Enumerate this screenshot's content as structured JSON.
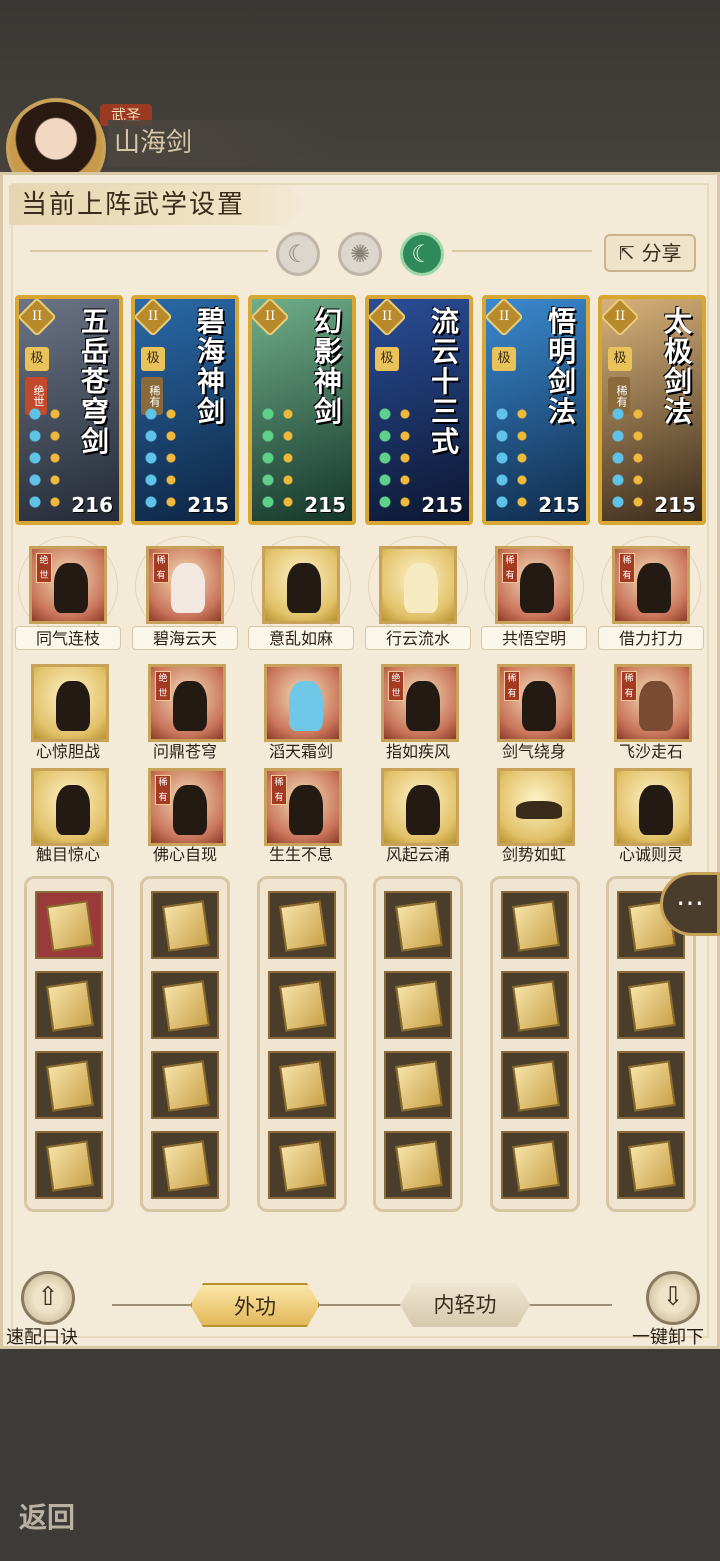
{
  "header": {
    "rank": "武圣",
    "current_skill": "山海剑"
  },
  "panel": {
    "title": "当前上阵武学设置",
    "share_label": "分享",
    "share_icon": "share-icon"
  },
  "modes": [
    {
      "name": "moon-mode",
      "icon": "crescent-icon"
    },
    {
      "name": "sun-mode",
      "icon": "sun-icon"
    },
    {
      "name": "jade-mode",
      "icon": "jade-moon-icon",
      "active": true
    }
  ],
  "cards": [
    {
      "name": "五岳苍穹剑",
      "level": "II",
      "grade": "极",
      "rarity": "绝世",
      "power": "216"
    },
    {
      "name": "碧海神剑",
      "level": "II",
      "grade": "极",
      "rarity": "稀有",
      "power": "215"
    },
    {
      "name": "幻影神剑",
      "level": "II",
      "grade": "",
      "rarity": "",
      "power": "215"
    },
    {
      "name": "流云十三式",
      "level": "II",
      "grade": "极",
      "rarity": "",
      "power": "215"
    },
    {
      "name": "悟明剑法",
      "level": "II",
      "grade": "极",
      "rarity": "",
      "power": "215"
    },
    {
      "name": "太极剑法",
      "level": "II",
      "grade": "极",
      "rarity": "稀有",
      "power": "215"
    }
  ],
  "skills_row1": [
    {
      "label": "同气连枝",
      "tag": "绝世"
    },
    {
      "label": "碧海云天",
      "tag": "稀有"
    },
    {
      "label": "意乱如麻",
      "tag": ""
    },
    {
      "label": "行云流水",
      "tag": ""
    },
    {
      "label": "共悟空明",
      "tag": "稀有"
    },
    {
      "label": "借力打力",
      "tag": "稀有"
    }
  ],
  "skills_row2": [
    {
      "label": "心惊胆战",
      "tag": ""
    },
    {
      "label": "问鼎苍穹",
      "tag": "绝世"
    },
    {
      "label": "滔天霜剑",
      "tag": ""
    },
    {
      "label": "指如疾风",
      "tag": "绝世"
    },
    {
      "label": "剑气绕身",
      "tag": "稀有"
    },
    {
      "label": "飞沙走石",
      "tag": "稀有"
    }
  ],
  "skills_row3": [
    {
      "label": "触目惊心",
      "tag": ""
    },
    {
      "label": "佛心自现",
      "tag": "稀有"
    },
    {
      "label": "生生不息",
      "tag": "稀有"
    },
    {
      "label": "风起云涌",
      "tag": ""
    },
    {
      "label": "剑势如虹",
      "tag": ""
    },
    {
      "label": "心诚则灵",
      "tag": ""
    }
  ],
  "footer": {
    "quick_equip": "速配口诀",
    "external_tab": "外功",
    "internal_tab": "内轻功",
    "unequip_all": "一键卸下",
    "back": "返回"
  },
  "colors": {
    "panel_bg": "#f3ead8",
    "card_border": "#d8a632",
    "active_mode": "#2f8a5a"
  }
}
